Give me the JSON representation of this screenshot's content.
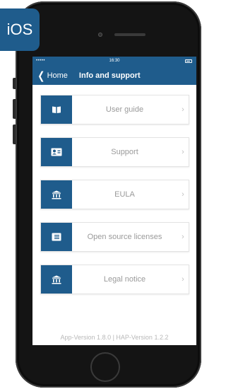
{
  "badge": {
    "label": "iOS"
  },
  "status_bar": {
    "signal": "•••••",
    "time": "16:30"
  },
  "nav_bar": {
    "back_label": "Home",
    "title": "Info and support"
  },
  "menu": [
    {
      "label": "User guide",
      "icon": "book-icon"
    },
    {
      "label": "Support",
      "icon": "contact-card-icon"
    },
    {
      "label": "EULA",
      "icon": "institution-icon"
    },
    {
      "label": "Open source licenses",
      "icon": "document-icon"
    },
    {
      "label": "Legal notice",
      "icon": "institution-icon"
    }
  ],
  "footer": {
    "version": "App-Version 1.8.0 | HAP-Version 1.2.2"
  },
  "colors": {
    "accent": "#1f5c8c",
    "label": "#9a9a9a",
    "device": "#141414"
  }
}
